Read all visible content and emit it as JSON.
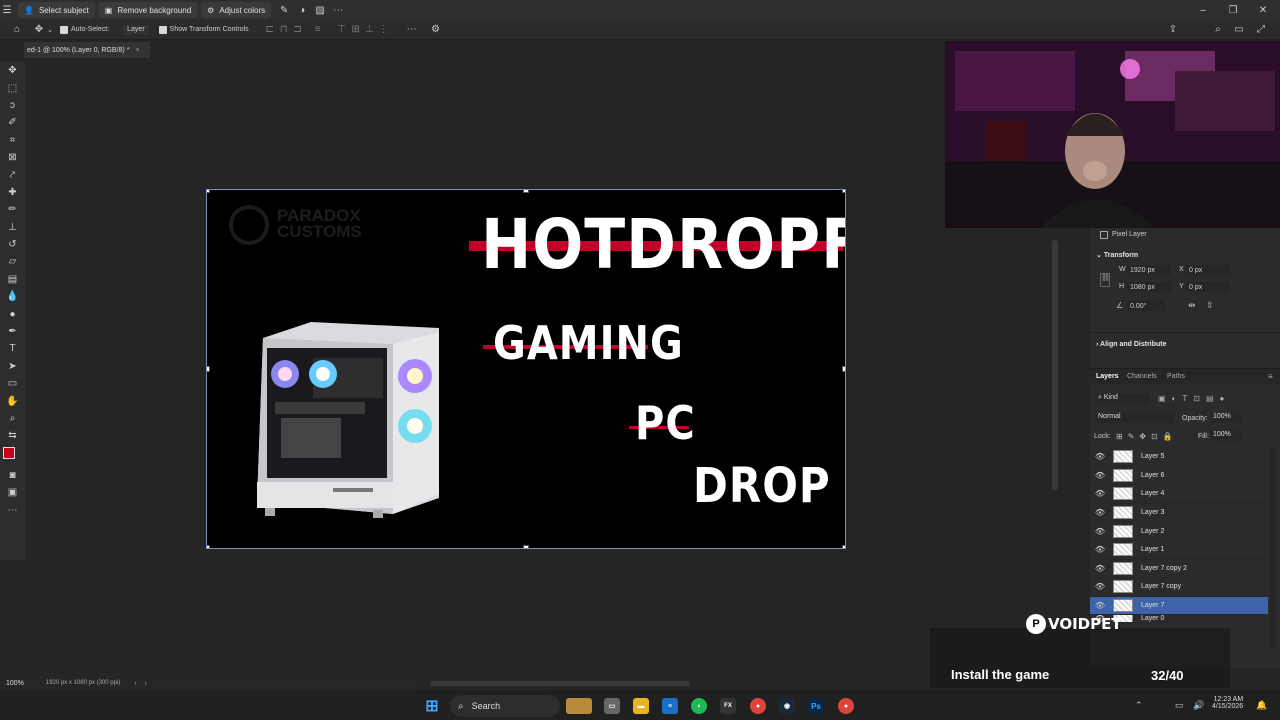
{
  "appbar": {
    "select_subject": "Select subject",
    "remove_background": "Remove background",
    "adjust_colors": "Adjust colors"
  },
  "options": {
    "auto_select_label": "Auto-Select:",
    "auto_select_value": "Layer",
    "show_transform_label": "Show Transform Controls"
  },
  "doc_tab": {
    "label": "ed-1 @ 100% (Layer 0, RGB/8) *"
  },
  "canvas": {
    "watermark_line1": "PARADOX",
    "watermark_line2": "CUSTOMS",
    "title": "HOTDROPFPS",
    "word1": "GAMING",
    "word2": "PC",
    "word3": "DROP",
    "accent_red": "#c3002a"
  },
  "properties": {
    "layer_kind": "Pixel Layer",
    "transform_label": "Transform",
    "w_label": "W",
    "w_value": "1920 px",
    "h_label": "H",
    "h_value": "1080 px",
    "x_label": "X",
    "x_value": "0 px",
    "y_label": "Y",
    "y_value": "0 px",
    "angle_value": "0.00°",
    "align_label": "Align and Distribute"
  },
  "layers_panel": {
    "tabs": [
      "Layers",
      "Channels",
      "Paths"
    ],
    "filter": "Kind",
    "blend_mode": "Normal",
    "opacity_label": "Opacity:",
    "opacity_value": "100%",
    "lock_label": "Lock:",
    "fill_label": "Fill:",
    "fill_value": "100%",
    "layers": [
      {
        "name": "Layer 5"
      },
      {
        "name": "Layer 6"
      },
      {
        "name": "Layer 4"
      },
      {
        "name": "Layer 3"
      },
      {
        "name": "Layer 2"
      },
      {
        "name": "Layer 1"
      },
      {
        "name": "Layer 7 copy 2"
      },
      {
        "name": "Layer 7 copy"
      },
      {
        "name": "Layer 7",
        "selected": true
      },
      {
        "name": "Layer 0"
      }
    ]
  },
  "status": {
    "zoom": "100%",
    "doc_info": "1920 px x 1080 px (300 ppi)"
  },
  "overlay": {
    "brand": "VOIDPET",
    "message": "Install the game",
    "counter": "32/40",
    "progress": 0.8
  },
  "taskbar": {
    "search_label": "Search",
    "time": "12:23 AM",
    "date": "4/15/2026"
  }
}
